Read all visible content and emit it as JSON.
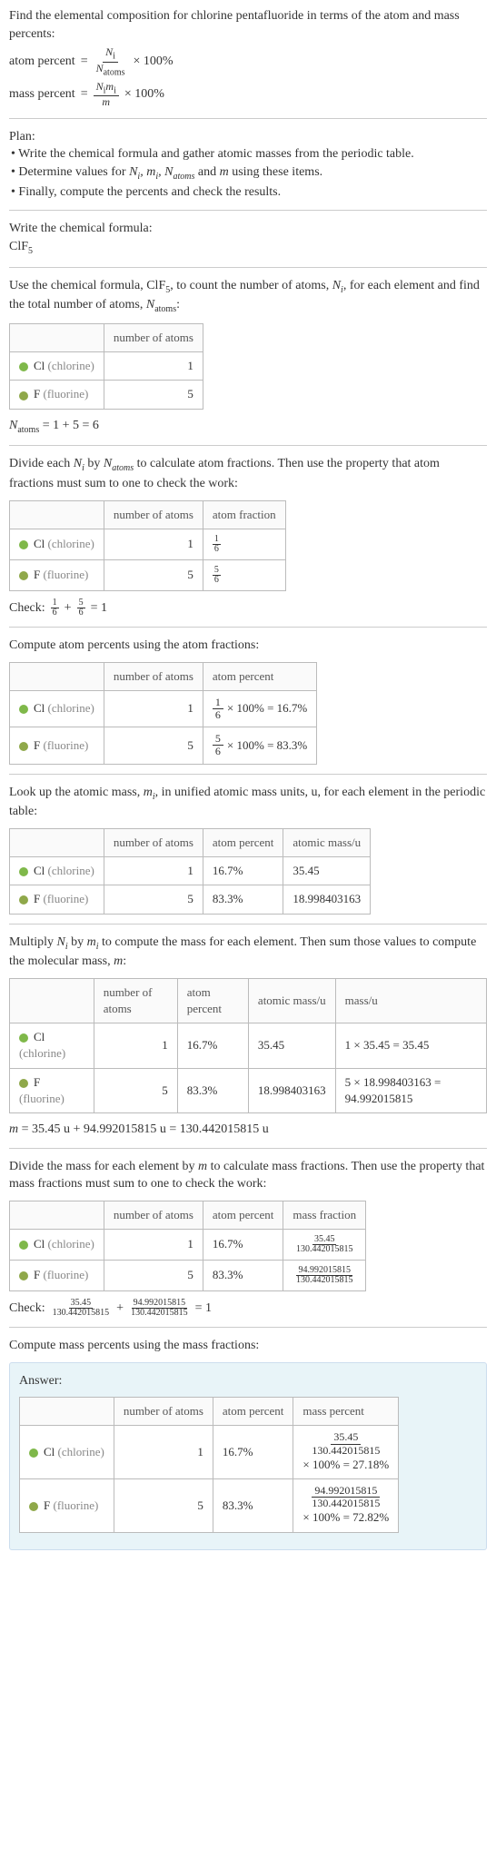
{
  "intro": {
    "line1": "Find the elemental composition for chlorine pentafluoride in terms of the atom and mass percents:",
    "atom_percent_label": "atom percent",
    "mass_percent_label": "mass percent",
    "eq": "=",
    "times100": "× 100%",
    "Ni": "N",
    "Ni_sub": "i",
    "Natoms": "N",
    "Natoms_sub": "atoms",
    "Nimi_num": "N",
    "Nimi_num_sub_i": "i",
    "Nimi_num_m": "m",
    "Nimi_num_sub_i2": "i",
    "m": "m"
  },
  "plan": {
    "title": "Plan:",
    "b1": "• Write the chemical formula and gather atomic masses from the periodic table.",
    "b2_a": "• Determine values for ",
    "b2_b": " using these items.",
    "vars": "N_i, m_i, N_atoms and m",
    "b3": "• Finally, compute the percents and check the results."
  },
  "formula": {
    "title": "Write the chemical formula:",
    "value": "ClF",
    "sub": "5"
  },
  "count": {
    "text_a": "Use the chemical formula, ClF",
    "text_sub": "5",
    "text_b": ", to count the number of atoms, ",
    "text_c": ", for each element and find the total number of atoms, ",
    "text_d": ":",
    "Ni": "N",
    "Ni_sub": "i",
    "Natoms": "N",
    "Natoms_sub": "atoms",
    "hdr_atoms": "number of atoms",
    "cl_label": "Cl",
    "cl_paren": " (chlorine)",
    "f_label": "F",
    "f_paren": " (fluorine)",
    "cl_n": "1",
    "f_n": "5",
    "sum_a": "N",
    "sum_sub": "atoms",
    "sum_b": " = 1 + 5 = 6"
  },
  "atomfrac": {
    "text": "Divide each N_i by N_atoms to calculate atom fractions. Then use the property that atom fractions must sum to one to check the work:",
    "text_a": "Divide each ",
    "text_b": " by ",
    "text_c": " to calculate atom fractions. Then use the property that atom fractions must sum to one to check the work:",
    "hdr_atoms": "number of atoms",
    "hdr_frac": "atom fraction",
    "cl_n": "1",
    "f_n": "5",
    "cl_num": "1",
    "cl_den": "6",
    "f_num": "5",
    "f_den": "6",
    "check_label": "Check: ",
    "check_eq": " = 1"
  },
  "atompct": {
    "text": "Compute atom percents using the atom fractions:",
    "hdr_atoms": "number of atoms",
    "hdr_pct": "atom percent",
    "cl_n": "1",
    "f_n": "5",
    "cl_num": "1",
    "cl_den": "6",
    "cl_res": " × 100% = 16.7%",
    "f_num": "5",
    "f_den": "6",
    "f_res": " × 100% = 83.3%"
  },
  "atomicmass": {
    "text_a": "Look up the atomic mass, ",
    "text_b": ", in unified atomic mass units, u, for each element in the periodic table:",
    "mi": "m",
    "mi_sub": "i",
    "hdr_atoms": "number of atoms",
    "hdr_pct": "atom percent",
    "hdr_mass": "atomic mass/u",
    "cl_n": "1",
    "cl_pct": "16.7%",
    "cl_mass": "35.45",
    "f_n": "5",
    "f_pct": "83.3%",
    "f_mass": "18.998403163"
  },
  "molmass": {
    "text_a": "Multiply ",
    "text_b": " by ",
    "text_c": " to compute the mass for each element. Then sum those values to compute the molecular mass, ",
    "text_d": ":",
    "Ni": "N",
    "Ni_sub": "i",
    "mi": "m",
    "mi_sub": "i",
    "m": "m",
    "hdr_atoms": "number of atoms",
    "hdr_pct": "atom percent",
    "hdr_amass": "atomic mass/u",
    "hdr_mass": "mass/u",
    "cl_n": "1",
    "cl_pct": "16.7%",
    "cl_amass": "35.45",
    "cl_mass": "1 × 35.45 = 35.45",
    "f_n": "5",
    "f_pct": "83.3%",
    "f_amass": "18.998403163",
    "f_mass": "5 × 18.998403163 = 94.992015815",
    "sum": "m = 35.45 u + 94.992015815 u = 130.442015815 u"
  },
  "massfrac": {
    "text_a": "Divide the mass for each element by ",
    "text_b": " to calculate mass fractions. Then use the property that mass fractions must sum to one to check the work:",
    "m": "m",
    "hdr_atoms": "number of atoms",
    "hdr_pct": "atom percent",
    "hdr_mfrac": "mass fraction",
    "cl_n": "1",
    "cl_pct": "16.7%",
    "cl_num": "35.45",
    "cl_den": "130.442015815",
    "f_n": "5",
    "f_pct": "83.3%",
    "f_num": "94.992015815",
    "f_den": "130.442015815",
    "check_label": "Check: ",
    "check_plus": " + ",
    "check_eq": " = 1"
  },
  "masspct": {
    "text": "Compute mass percents using the mass fractions:"
  },
  "answer": {
    "title": "Answer:",
    "hdr_atoms": "number of atoms",
    "hdr_apct": "atom percent",
    "hdr_mpct": "mass percent",
    "cl_n": "1",
    "cl_apct": "16.7%",
    "cl_num": "35.45",
    "cl_den": "130.442015815",
    "cl_res": "× 100% = 27.18%",
    "f_n": "5",
    "f_apct": "83.3%",
    "f_num": "94.992015815",
    "f_den": "130.442015815",
    "f_res": "× 100% = 72.82%"
  },
  "elem": {
    "cl_label": "Cl",
    "cl_paren": " (chlorine)",
    "f_label": "F",
    "f_paren": " (fluorine)"
  }
}
